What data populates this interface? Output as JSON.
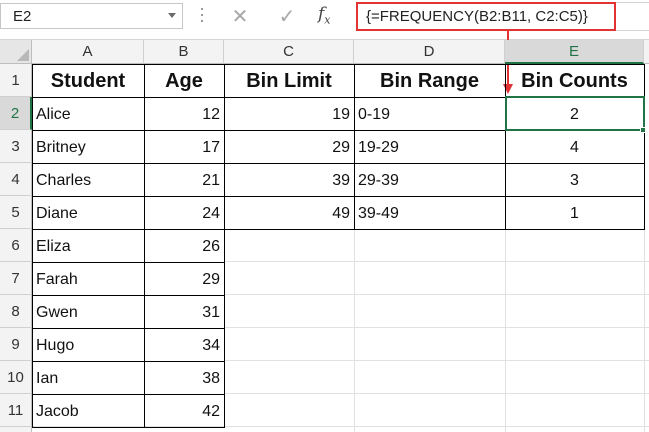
{
  "formula_bar": {
    "name_box": "E2",
    "cancel_icon": "✕",
    "enter_icon": "✓",
    "fx_label": "fx",
    "formula": "{=FREQUENCY(B2:B11, C2:C5)}"
  },
  "sheet": {
    "columns": [
      "A",
      "B",
      "C",
      "D",
      "E"
    ],
    "rows": [
      "1",
      "2",
      "3",
      "4",
      "5",
      "6",
      "7",
      "8",
      "9",
      "10",
      "11"
    ],
    "active_cell": "E2",
    "headers": {
      "student": "Student",
      "age": "Age",
      "bin_limit": "Bin Limit",
      "bin_range": "Bin Range",
      "bin_counts": "Bin Counts"
    },
    "students": [
      {
        "name": "Alice",
        "age": "12"
      },
      {
        "name": "Britney",
        "age": "17"
      },
      {
        "name": "Charles",
        "age": "21"
      },
      {
        "name": "Diane",
        "age": "24"
      },
      {
        "name": "Eliza",
        "age": "26"
      },
      {
        "name": "Farah",
        "age": "29"
      },
      {
        "name": "Gwen",
        "age": "31"
      },
      {
        "name": "Hugo",
        "age": "34"
      },
      {
        "name": "Ian",
        "age": "38"
      },
      {
        "name": "Jacob",
        "age": "42"
      }
    ],
    "bins": [
      {
        "limit": "19",
        "range": "0-19",
        "count": "2"
      },
      {
        "limit": "29",
        "range": "19-29",
        "count": "4"
      },
      {
        "limit": "39",
        "range": "29-39",
        "count": "3"
      },
      {
        "limit": "49",
        "range": "39-49",
        "count": "1"
      }
    ]
  },
  "colors": {
    "selection": "#217346",
    "callout": "#e23232"
  }
}
